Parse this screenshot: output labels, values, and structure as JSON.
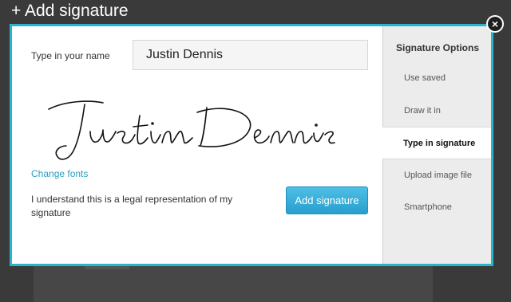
{
  "modal": {
    "title": "+ Add signature",
    "close_icon": "×"
  },
  "form": {
    "name_label": "Type in your name",
    "name_value": "Justin Dennis",
    "change_fonts_label": "Change fonts",
    "legal_text": "I understand this is a legal representation of my signature",
    "add_button_label": "Add signature"
  },
  "signature_preview": {
    "text": "Justin Dennis"
  },
  "options": {
    "title": "Signature Options",
    "items": [
      {
        "label": "Use saved",
        "active": false
      },
      {
        "label": "Draw it in",
        "active": false
      },
      {
        "label": "Type in signature",
        "active": true
      },
      {
        "label": "Upload image file",
        "active": false
      },
      {
        "label": "Smartphone",
        "active": false
      }
    ]
  },
  "colors": {
    "accent": "#2ab3cc",
    "link": "#2a9fbf",
    "button": "#279fcd",
    "overlay": "#3a3a3a"
  }
}
